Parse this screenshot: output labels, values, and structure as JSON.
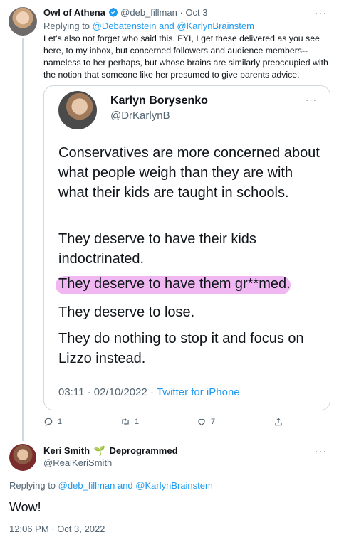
{
  "tweet1": {
    "display_name": "Owl of Athena",
    "handle": "@deb_fillman",
    "separator": "·",
    "date": "Oct 3",
    "more": "···",
    "replying_prefix": "Replying to",
    "replying_to": "@Debatenstein and @KarlynBrainstem",
    "text": "Let's also not forget who said this. FYI, I get these delivered as you see here, to my inbox, but concerned followers and audience members--nameless to her perhaps, but whose brains are similarly preoccupied with the notion that someone like her presumed to give parents advice.",
    "quote": {
      "display_name": "Karlyn Borysenko",
      "handle": "@DrKarlynB",
      "more": "···",
      "paragraphs": [
        "Conservatives are more concerned about what people weigh than they are with what their kids are taught in schools.",
        "They deserve to have their kids indoctrinated.",
        "They deserve to have them gr**med.",
        "They deserve to lose.",
        "They do nothing to stop it and focus on Lizzo instead."
      ],
      "time": "03:11 · 02/10/2022 ·",
      "source": "Twitter for iPhone"
    },
    "actions": {
      "reply_count": "1",
      "retweet_count": "1",
      "like_count": "7"
    }
  },
  "tweet2": {
    "display_name": "Keri Smith",
    "badge_text": "Deprogrammed",
    "handle": "@RealKeriSmith",
    "more": "···",
    "replying_prefix": "Replying to",
    "replying_to": "@deb_fillman and @KarlynBrainstem",
    "text": "Wow!",
    "timestamp": "12:06 PM · Oct 3, 2022"
  },
  "colors": {
    "link": "#1d9bf0",
    "highlight": "#eeaaf0",
    "secondary_text": "#536471"
  },
  "icons": [
    "verified-badge-icon",
    "reply-icon",
    "retweet-icon",
    "like-icon",
    "share-icon",
    "sprout-icon",
    "more-icon"
  ]
}
